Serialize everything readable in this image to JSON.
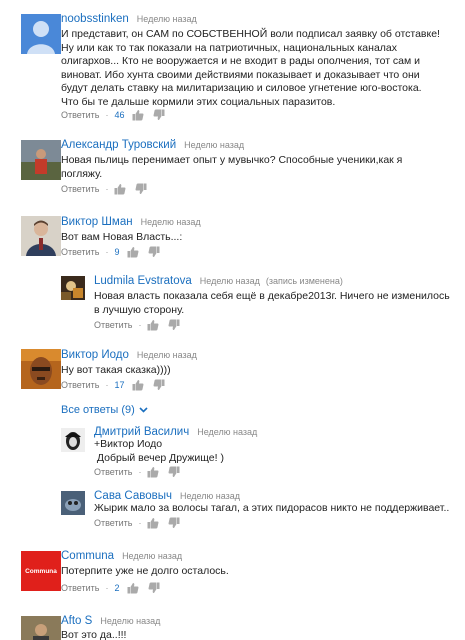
{
  "comments": [
    {
      "author": "noobsstinken",
      "time": "Неделю назад",
      "lines": [
        "И представит, он САМ по СОБСТВЕННОЙ воли подписал заявку об отставке!",
        "Ну или как то так показали на патриотичных, национальных каналах",
        "олигархов... Кто не вооружается и не входит в рады ополчения, тот сам и",
        "виноват. Ибо хунта своими действиями показывает и доказывает что они",
        "будут делать ставку на милитаризацию и силовое угнетение юго-востока.",
        "Что бы те дальше кормили этих социальных паразитов."
      ],
      "reply_label": "Ответить",
      "likes": "46"
    },
    {
      "author": "Александр Туровский",
      "time": "Неделю назад",
      "lines": [
        "Новая пьлиць перенимает опыт у мувычко? Способные ученики,как я",
        "погляжу."
      ],
      "reply_label": "Ответить",
      "likes": ""
    },
    {
      "author": "Виктор Шман",
      "time": "Неделю назад",
      "lines": [
        "Вот вам Новая Власть...:"
      ],
      "reply_label": "Ответить",
      "likes": "9"
    },
    {
      "author": "Ludmila Evstratova",
      "time": "Неделю назад",
      "edited": "(запись изменена)",
      "lines": [
        "Новая власть показала себя ещё в декабре2013г. Ничего не изменилось",
        "в лучшую сторону."
      ],
      "reply_label": "Ответить",
      "likes": ""
    },
    {
      "author": "Виктор Иодо",
      "time": "Неделю назад",
      "lines": [
        "Ну вот такая сказка))))"
      ],
      "reply_label": "Ответить",
      "likes": "17"
    },
    {
      "author": "Дмитрий Василич",
      "time": "Неделю назад",
      "lines": [
        "+Виктор Иодо",
        " Добрый вечер Дружище! )"
      ],
      "reply_label": "Ответить",
      "likes": ""
    },
    {
      "author": "Сава Савовыч",
      "time": "Неделю назад",
      "lines": [
        "Жырик мало за волосы тагал, а этих пидорасов никто не поддерживает.."
      ],
      "reply_label": "Ответить",
      "likes": ""
    },
    {
      "author": "Communa",
      "time": "Неделю назад",
      "lines": [
        "Потерпите уже не долго осталось."
      ],
      "reply_label": "Ответить",
      "likes": "2",
      "avatar_text": "Communa"
    },
    {
      "author": "Afto S",
      "time": "Неделю назад",
      "lines": [
        "Вот это да..!!!"
      ],
      "reply_label": "",
      "likes": ""
    }
  ],
  "show_replies": "Все ответы (9)",
  "colors": {
    "link": "#1b6fbf",
    "muted": "#777777",
    "communa_red": "#e0201b"
  }
}
